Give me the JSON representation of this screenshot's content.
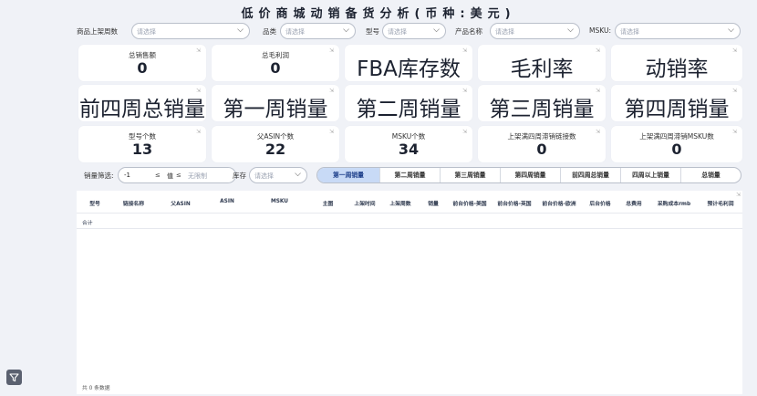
{
  "title": "低价商城动销备货分析(币种:美元)",
  "filters": [
    {
      "label": "商品上架周数",
      "placeholder": "请选择"
    },
    {
      "label": "品类",
      "placeholder": "请选择"
    },
    {
      "label": "型号",
      "placeholder": "请选择"
    },
    {
      "label": "产品名称",
      "placeholder": "请选择"
    },
    {
      "label": "MSKU:",
      "placeholder": "请选择"
    }
  ],
  "row1": [
    {
      "label": "总销售额",
      "value": "0"
    },
    {
      "label": "总毛利润",
      "value": "0"
    },
    {
      "label": "FBA库存数"
    },
    {
      "label": "毛利率"
    },
    {
      "label": "动销率"
    }
  ],
  "row2": [
    "前四周总销量",
    "第一周销量",
    "第二周销量",
    "第三周销量",
    "第四周销量"
  ],
  "row3": [
    {
      "label": "型号个数",
      "value": "13"
    },
    {
      "label": "父ASIN个数",
      "value": "22"
    },
    {
      "label": "MSKU个数",
      "value": "34"
    },
    {
      "label": "上架满四周滞销链接数",
      "value": "0"
    },
    {
      "label": "上架满四周滞销MSKU数",
      "value": "0"
    }
  ],
  "sales_filter": {
    "label": "销量筛选:",
    "min": "-1",
    "le1": "≤",
    "mid": "值",
    "le2": "≤",
    "max_placeholder": "无限制"
  },
  "stock_filter": {
    "label": "库存",
    "placeholder": "请选择"
  },
  "tabs": [
    "第一周销量",
    "第二周销量",
    "第三周销量",
    "第四周销量",
    "前四周总销量",
    "四周以上销量",
    "总销量"
  ],
  "table": {
    "columns": [
      "型号",
      "链接名称",
      "父ASIN",
      "ASIN",
      "MSKU",
      "主图",
      "上架时间",
      "上架周数",
      "销量",
      "前台价格-美国",
      "前台价格-英国",
      "前台价格-欧洲",
      "后台价格",
      "总费用",
      "采购成本rmb",
      "预计毛利润"
    ],
    "total_label": "合计",
    "footer": "共 0 条数据"
  }
}
